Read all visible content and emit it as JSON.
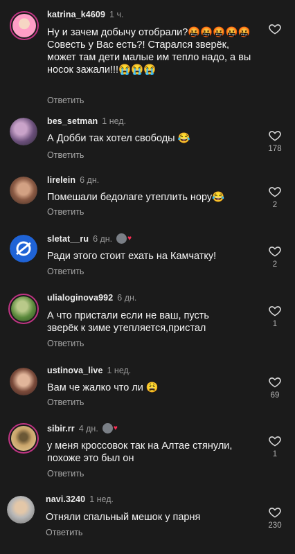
{
  "comments": [
    {
      "username": "katrina_k4609",
      "time": "1 ч.",
      "text": "Ну и зачем добычу отобрали?🤬🤬🤬🤬🤬 Совесть у Вас есть?! Старался зверёк, может там дети малые им тепло надо, а вы носок зажали!!!😭😭😭",
      "reply_label": "Ответить",
      "likes": "",
      "avatar_colors": [
        "#ff9ec6",
        "#55d0e0"
      ]
    },
    {
      "username": "bes_setman",
      "time": "1 нед.",
      "text": "А Добби так хотел свободы 😂",
      "reply_label": "Ответить",
      "likes": "178",
      "avatar_colors": [
        "#6a4f7a",
        "#c9a3c9"
      ]
    },
    {
      "username": "lirelein",
      "time": "6 дн.",
      "text": "Помешали бедолаге утеплить нору😂",
      "reply_label": "Ответить",
      "likes": "2",
      "avatar_colors": [
        "#8a5a44",
        "#d2a183"
      ]
    },
    {
      "username": "sletat__ru",
      "time": "6 дн.",
      "text": "Ради этого стоит ехать на Камчатку!",
      "reply_label": "Ответить",
      "likes": "2",
      "avatar_colors": [
        "#1f63d6",
        "#ffffff"
      ],
      "liked_by_author": true
    },
    {
      "username": "ulialoginova992",
      "time": "6 дн.",
      "text": "А что пристали если не ваш, пусть зверёк к зиме утепляется,пристал",
      "reply_label": "Ответить",
      "likes": "1",
      "avatar_colors": [
        "#5b8a3c",
        "#b9c98a"
      ]
    },
    {
      "username": "ustinova_live",
      "time": "1 нед.",
      "text": "Вам че жалко что ли 😩",
      "reply_label": "Ответить",
      "likes": "69",
      "avatar_colors": [
        "#7a4a3a",
        "#e1b59a"
      ]
    },
    {
      "username": "sibir.rr",
      "time": "4 дн.",
      "text": "у меня кроссовок так на Алтае стянули, похоже это был он",
      "reply_label": "Ответить",
      "likes": "1",
      "avatar_colors": [
        "#c9a46a",
        "#6b5836"
      ],
      "liked_by_author": true
    },
    {
      "username": "navi.3240",
      "time": "1 нед.",
      "text": "Отняли спальный мешок у парня",
      "reply_label": "Ответить",
      "likes": "230",
      "avatar_colors": [
        "#b7b7b7",
        "#e3c7a8"
      ]
    }
  ],
  "icons": {
    "like": "heart-outline-icon",
    "liked_by_creator": "heart-filled-icon"
  },
  "colors": {
    "background": "#1b1b1b",
    "text": "#f5f5f5",
    "secondary": "#a8a8a8",
    "story_ring": "#c13584",
    "heart": "#ff2d55"
  }
}
